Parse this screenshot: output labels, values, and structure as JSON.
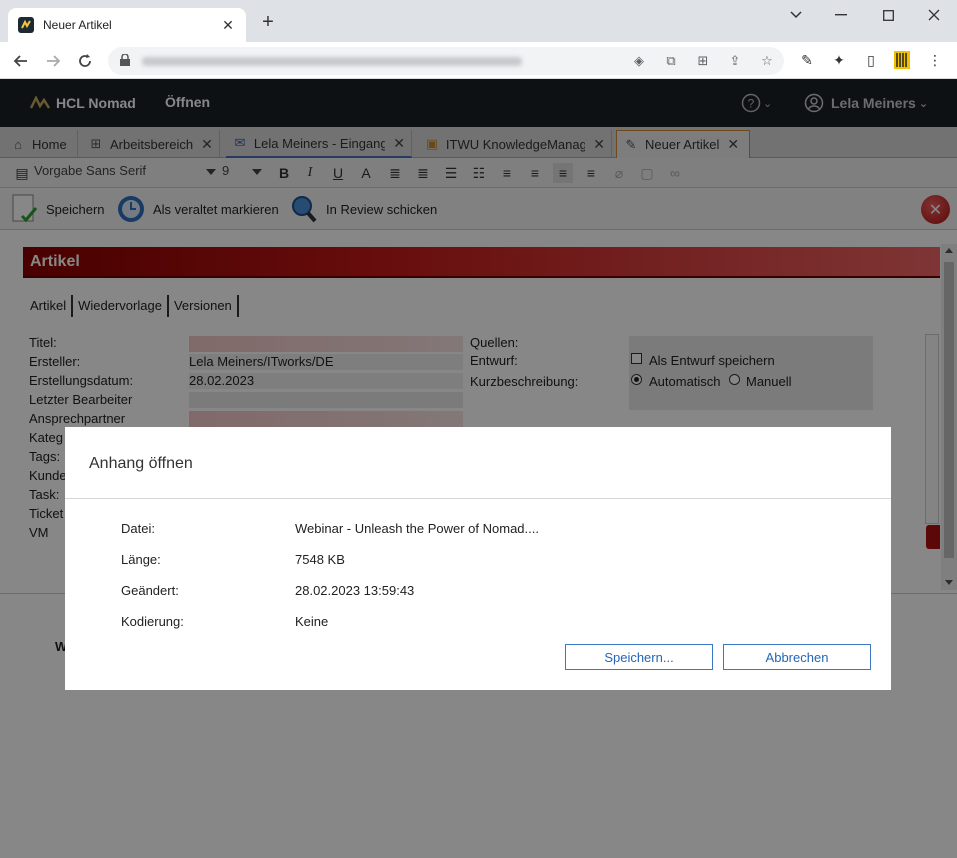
{
  "browser": {
    "tab_title": "Neuer Artikel",
    "new_tab": "+",
    "close_tab": "✕"
  },
  "app": {
    "name": "HCL Nomad",
    "open_label": "Öffnen",
    "user_name": "Lela Meiners"
  },
  "app_tabs": [
    {
      "label": "Home",
      "icon": "home-icon"
    },
    {
      "label": "Arbeitsbereich",
      "icon": "grid-icon"
    },
    {
      "label": "Lela Meiners - Eingang",
      "icon": "mail-icon"
    },
    {
      "label": "ITWU KnowledgeManag",
      "icon": "document-icon"
    },
    {
      "label": "Neuer Artikel",
      "icon": "pencil-icon"
    }
  ],
  "format_toolbar": {
    "font": "Vorgabe Sans Serif",
    "size": "9"
  },
  "actions": {
    "save": "Speichern",
    "mark_outdated": "Als veraltet markieren",
    "send_review": "In Review schicken"
  },
  "article": {
    "banner_title": "Artikel",
    "tabs": [
      "Artikel",
      "Wiedervorlage",
      "Versionen"
    ],
    "fields_left": [
      {
        "label": "Titel:",
        "value": ""
      },
      {
        "label": "Ersteller:",
        "value": "Lela Meiners/ITworks/DE"
      },
      {
        "label": "Erstellungsdatum:",
        "value": "28.02.2023"
      },
      {
        "label": "Letzter Bearbeiter",
        "value": ""
      },
      {
        "label": "Ansprechpartner",
        "value": ""
      },
      {
        "label": "Kateg",
        "value": ""
      },
      {
        "label": "Tags:",
        "value": ""
      },
      {
        "label": "Kunde",
        "value": ""
      },
      {
        "label": "Task:",
        "value": ""
      },
      {
        "label": "Ticket",
        "value": ""
      },
      {
        "label": "VM",
        "value": ""
      }
    ],
    "fields_right": {
      "sources_label": "Quellen:",
      "draft_label": "Entwurf:",
      "draft_checkbox": "Als Entwurf speichern",
      "summary_label": "Kurzbeschreibung:",
      "radio_auto": "Automatisch",
      "radio_manual": "Manuell"
    },
    "body_snippet": "W"
  },
  "dialog": {
    "title": "Anhang öffnen",
    "rows": [
      {
        "label": "Datei:",
        "value": "Webinar - Unleash the Power of Nomad...."
      },
      {
        "label": "Länge:",
        "value": "7548 KB"
      },
      {
        "label": "Geändert:",
        "value": "28.02.2023 13:59:43"
      },
      {
        "label": "Kodierung:",
        "value": "Keine"
      }
    ],
    "save_button": "Speichern...",
    "cancel_button": "Abbrechen"
  },
  "colors": {
    "app_header": "#1c2127",
    "banner_red": "#c51a1a",
    "dialog_button_blue": "#2366b8",
    "active_tab_border": "#d08a3a"
  }
}
